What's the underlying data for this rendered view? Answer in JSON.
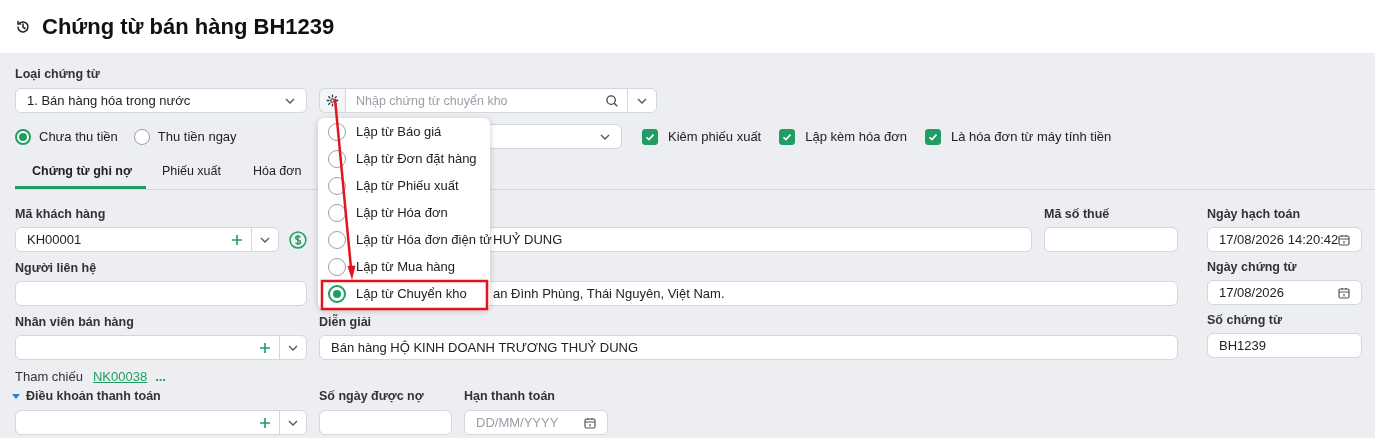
{
  "header": {
    "title": "Chứng từ bán hàng BH1239"
  },
  "voucher_type": {
    "label": "Loại chứng từ",
    "value": "1. Bán hàng hóa trong nước"
  },
  "transfer_search": {
    "placeholder": "Nhập chứng từ chuyển kho"
  },
  "create_from_menu": {
    "items": [
      {
        "label": "Lập từ Báo giá",
        "selected": false
      },
      {
        "label": "Lập từ Đơn đặt hàng",
        "selected": false
      },
      {
        "label": "Lập từ Phiếu xuất",
        "selected": false
      },
      {
        "label": "Lập từ Hóa đơn",
        "selected": false
      },
      {
        "label": "Lập từ Hóa đơn điện tử",
        "selected": false
      },
      {
        "label": "Lập từ Mua hàng",
        "selected": false
      },
      {
        "label": "Lập từ Chuyển kho",
        "selected": true
      }
    ]
  },
  "payment_options": [
    {
      "label": "Chưa thu tiền",
      "selected": true
    },
    {
      "label": "Thu tiền ngay",
      "selected": false
    }
  ],
  "options": [
    {
      "label": "Kiêm phiếu xuất",
      "checked": true
    },
    {
      "label": "Lập kèm hóa đơn",
      "checked": true
    },
    {
      "label": "Là hóa đơn từ máy tính tiền",
      "checked": true
    }
  ],
  "tabs": [
    {
      "label": "Chứng từ ghi nợ",
      "selected": true
    },
    {
      "label": "Phiếu xuất",
      "selected": false
    },
    {
      "label": "Hóa đơn",
      "selected": false
    }
  ],
  "customer_code": {
    "label": "Mã khách hàng",
    "value": "KH00001"
  },
  "customer_name": {
    "value": "HUỶ DUNG"
  },
  "tax_code": {
    "label": "Mã số thuế"
  },
  "contact": {
    "label": "Người liên hệ"
  },
  "address": {
    "value": "an Đình Phùng, Thái Nguyên, Việt Nam."
  },
  "salesperson": {
    "label": "Nhân viên bán hàng"
  },
  "description": {
    "label": "Diễn giải",
    "value": "Bán hàng HỘ KINH DOANH TRƯƠNG THUỶ DUNG"
  },
  "reference": {
    "label": "Tham chiếu",
    "link": "NK00038",
    "more": "..."
  },
  "payment_term": {
    "label": "Điều khoản thanh toán",
    "expanded": true
  },
  "credit_days": {
    "label": "Số ngày được nợ"
  },
  "due_date": {
    "label": "Hạn thanh toán",
    "placeholder": "DD/MM/YYYY"
  },
  "posting_date": {
    "label": "Ngày hạch toán",
    "value": "17/08/2026 14:20:42"
  },
  "voucher_date": {
    "label": "Ngày chứng từ",
    "value": "17/08/2026"
  },
  "voucher_no": {
    "label": "Số chứng từ",
    "value": "BH1239"
  }
}
